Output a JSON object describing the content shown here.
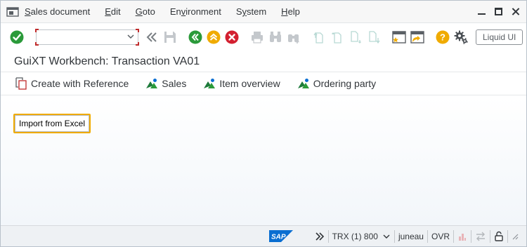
{
  "menubar": {
    "items": [
      {
        "label": "Sales document",
        "mnemonic": "S",
        "rest": "ales document"
      },
      {
        "label": "Edit",
        "mnemonic": "E",
        "rest": "dit"
      },
      {
        "label": "Goto",
        "mnemonic": "G",
        "rest": "oto"
      },
      {
        "label": "Environment",
        "pre": "En",
        "mnemonic": "v",
        "rest": "ironment"
      },
      {
        "label": "System",
        "pre": "S",
        "mnemonic": "y",
        "rest": "stem"
      },
      {
        "label": "Help",
        "mnemonic": "H",
        "rest": "elp"
      }
    ],
    "icons": [
      "system-menu-icon",
      "minimize-icon",
      "maximize-icon",
      "close-window-icon"
    ]
  },
  "toolbar": {
    "command_field_value": "",
    "liquid_ui_label": "Liquid UI",
    "icons": [
      "enter-icon",
      "command-field-dropdown-icon",
      "history-back-icon",
      "save-icon",
      "back-icon",
      "exit-icon",
      "cancel-icon",
      "print-icon",
      "find-icon",
      "find-next-icon",
      "first-page-icon",
      "previous-page-icon",
      "next-page-icon",
      "last-page-icon",
      "create-session-icon",
      "shortcut-icon",
      "help-icon",
      "settings-gear-icon"
    ],
    "colors": {
      "enter": "#2b9a3a",
      "back": "#2b9a3a",
      "exit": "#f0ab00",
      "cancel": "#d32030",
      "help": "#f0ab00"
    }
  },
  "title": "GuiXT Workbench: Transaction VA01",
  "app_toolbar": {
    "buttons": [
      {
        "label": "Create with Reference",
        "icon": "document-reference-icon"
      },
      {
        "label": "Sales",
        "icon": "sales-mountain-icon"
      },
      {
        "label": "Item overview",
        "icon": "item-overview-mountain-icon"
      },
      {
        "label": "Ordering party",
        "icon": "ordering-party-mountain-icon"
      }
    ]
  },
  "content": {
    "import_button_label": "Import from Excel",
    "focus_color": "#f0ab00"
  },
  "statusbar": {
    "transaction": "TRX (1) 800",
    "server": "juneau",
    "mode": "OVR",
    "icons": [
      "sap-logo",
      "status-expand-icon",
      "status-dropdown-icon",
      "bar-chart-icon",
      "transfer-icon",
      "lock-icon",
      "resize-grip-icon"
    ]
  }
}
